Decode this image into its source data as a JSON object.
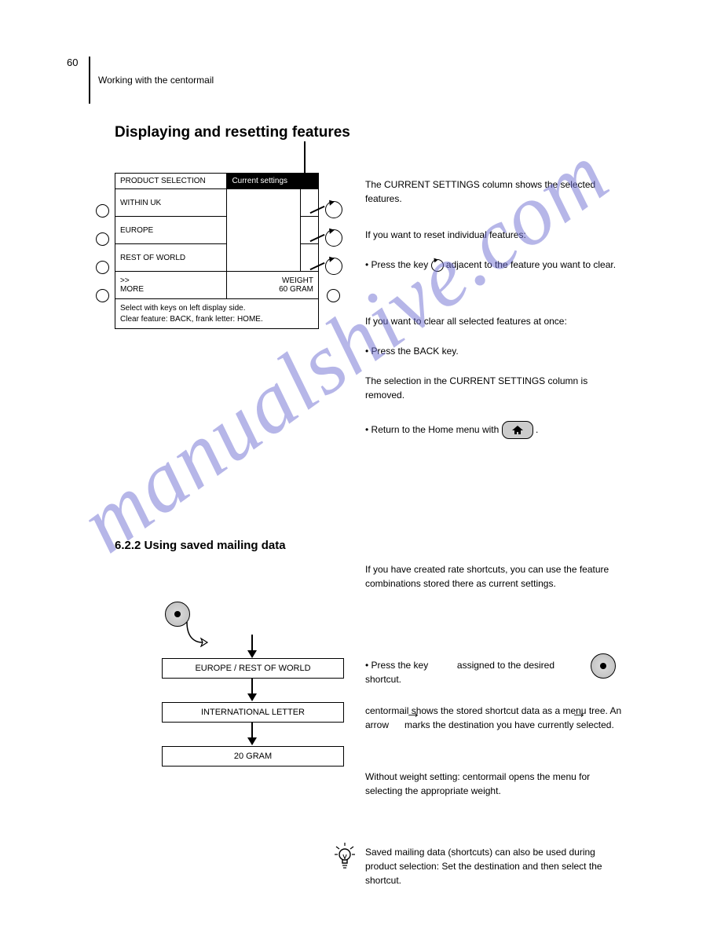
{
  "page": {
    "number": "60",
    "section": "Working with the centormail",
    "subtitle": "Displaying and resetting features"
  },
  "panel": {
    "header_left": "PRODUCT SELECTION",
    "header_right": "Current settings",
    "rows": [
      "WITHIN UK",
      "EUROPE",
      "REST OF WORLD"
    ],
    "more": ">>\nMORE",
    "weight_label": "WEIGHT",
    "weight_value": "60 GRAM",
    "footer_line1": "Select with keys on left display side.",
    "footer_line2": "Clear feature: BACK,  frank letter: HOME."
  },
  "right1": "The CURRENT SETTINGS column shows the selected features.",
  "right2": "If you want to reset individual features:",
  "right3_a": "• Press the key ",
  "right3_b": " adjacent to the feature you want to clear.",
  "right4": "If you want to clear all selected features at once:",
  "right5": "• Press the BACK key.",
  "right6": "The selection in the CURRENT SETTINGS column is removed.",
  "right7_a": "• Return to the Home menu with ",
  "right7_b": ".",
  "section62": "6.2.2    Using saved mailing data",
  "intro62": "If you have created rate shortcuts, you can use the feature combinations stored there as current settings.",
  "flow": {
    "box1": "EUROPE / REST OF WORLD",
    "box2": "INTERNATIONAL LETTER",
    "box3": "20 GRAM"
  },
  "r_flow1_a": "• Press the key ",
  "r_flow1_b": " assigned to the desired shortcut.",
  "r_flow2": "centormail shows the stored shortcut data as a menu tree. An arrow      marks the destination you have currently selected.",
  "r_flow3": "Without weight setting: centormail opens the menu for selecting the appropriate weight.",
  "tip": "Saved mailing data (shortcuts) can also be used during product selection:\nSet the destination and then select the shortcut."
}
